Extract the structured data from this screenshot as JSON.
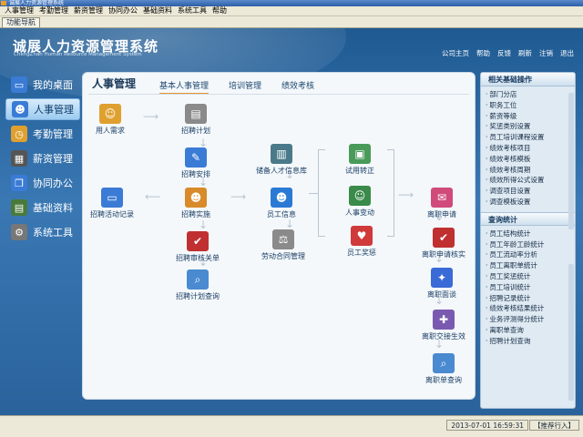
{
  "window": {
    "title": "诚展人力资源管理系统"
  },
  "menubar": [
    "人事管理",
    "考勤管理",
    "薪资管理",
    "协同办公",
    "基础资料",
    "系统工具",
    "帮助"
  ],
  "toolbar": {
    "tab": "功能导航"
  },
  "brand": {
    "title": "诚展人力资源管理系统",
    "subtitle": "ChengZhan Human Resource Management System"
  },
  "toplinks": [
    "公司主页",
    "帮助",
    "反馈",
    "刷新",
    "注销",
    "退出"
  ],
  "leftnav": [
    {
      "label": "我的桌面",
      "icon": "monitor-icon",
      "color": "#3a7bd5"
    },
    {
      "label": "人事管理",
      "icon": "people-icon",
      "color": "#3a7bd5",
      "active": true
    },
    {
      "label": "考勤管理",
      "icon": "clock-icon",
      "color": "#e0a030"
    },
    {
      "label": "薪资管理",
      "icon": "calculator-icon",
      "color": "#555"
    },
    {
      "label": "协同办公",
      "icon": "documents-icon",
      "color": "#3a7bd5"
    },
    {
      "label": "基础资料",
      "icon": "book-icon",
      "color": "#4a7a3a"
    },
    {
      "label": "系统工具",
      "icon": "gear-icon",
      "color": "#777"
    }
  ],
  "content": {
    "title": "人事管理",
    "tabs": [
      "基本人事管理",
      "培训管理",
      "绩效考核"
    ],
    "nodes": {
      "n1": "用人需求",
      "n2": "招聘计划",
      "n3": "招聘安排",
      "n4": "招聘实施",
      "n5": "招聘审核关单",
      "n6": "招聘计划查询",
      "n7": "招聘活动记录",
      "n8": "储备人才信息库",
      "n9": "员工信息",
      "n10": "劳动合同管理",
      "n11": "试用转正",
      "n12": "人事变动",
      "n13": "员工奖惩",
      "n14": "离职申请",
      "n15": "离职申请核实",
      "n16": "离职面谈",
      "n17": "离职交接生效",
      "n18": "离职单查询"
    }
  },
  "rightpanel": {
    "section1": {
      "title": "相关基础操作",
      "items": [
        "部门分店",
        "职务工位",
        "薪资等级",
        "奖惩类别设置",
        "员工培训课程设置",
        "绩效考核项目",
        "绩效考核模板",
        "绩效考核周期",
        "绩效所得公式设置",
        "调查项目设置",
        "调查模板设置"
      ]
    },
    "section2": {
      "title": "查询统计",
      "items": [
        "员工结构统计",
        "员工年龄工龄统计",
        "员工流动率分析",
        "员工离职单统计",
        "员工奖惩统计",
        "员工培训统计",
        "招聘记录统计",
        "绩效考核结果统计",
        "业务评测得分统计",
        "离职单查询",
        "招聘计划查询"
      ]
    }
  },
  "status": {
    "datetime": "2013-07-01 16:59:31",
    "flag": "【推荐行入】"
  }
}
